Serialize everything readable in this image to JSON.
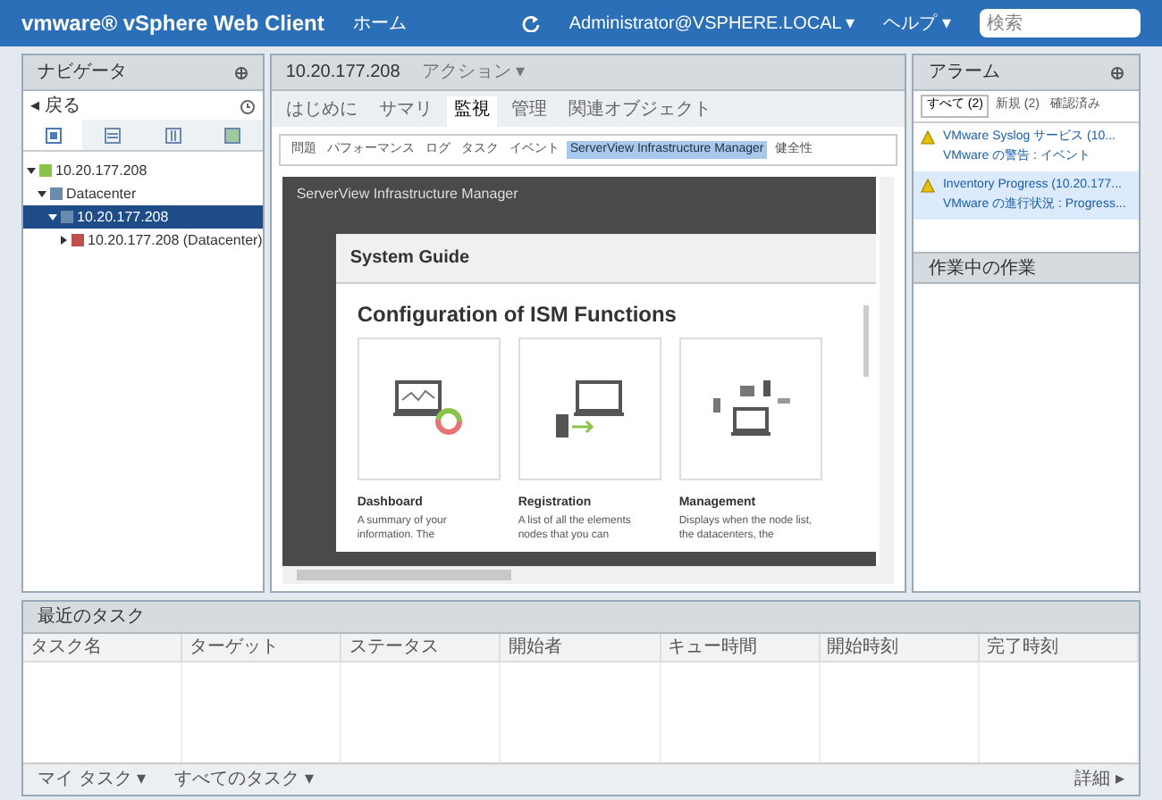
{
  "header": {
    "product": "vmware® vSphere Web Client",
    "home": "ホーム",
    "user": "Administrator@VSPHERE.LOCAL ▾",
    "help": "ヘルプ ▾",
    "search": {
      "placeholder": "検索"
    }
  },
  "navigator": {
    "title": "ナビゲータ",
    "back": "◂ 戻る",
    "tabs": [
      {
        "selected": true
      },
      {
        "selected": false
      },
      {
        "selected": false
      },
      {
        "selected": false
      }
    ],
    "tree": [
      {
        "label": "10.20.177.208",
        "selected": false,
        "expanded": true,
        "children": [
          {
            "label": "Datacenter",
            "selected": false,
            "expanded": true,
            "children": [
              {
                "label": "10.20.177.208",
                "selected": true,
                "expanded": true,
                "children": [
                  {
                    "label": "10.20.177.208 (Datacenter)",
                    "selected": false,
                    "expanded": false
                  }
                ]
              }
            ]
          }
        ]
      }
    ]
  },
  "main": {
    "title": "10.20.177.208",
    "actions": "アクション ▾",
    "tabs": [
      {
        "label": "はじめに",
        "selected": false
      },
      {
        "label": "サマリ",
        "selected": false
      },
      {
        "label": "監視",
        "selected": true
      },
      {
        "label": "管理",
        "selected": false
      },
      {
        "label": "関連オブジェクト",
        "selected": false
      }
    ],
    "subtabs": [
      {
        "label": "問題",
        "selected": false
      },
      {
        "label": "パフォーマンス",
        "selected": false
      },
      {
        "label": "ログ",
        "selected": false
      },
      {
        "label": "タスク",
        "selected": false
      },
      {
        "label": "イベント",
        "selected": false
      },
      {
        "label": "ServerView Infrastructure Manager",
        "selected": true
      },
      {
        "label": "健全性",
        "selected": false
      }
    ],
    "app_title": "ServerView Infrastructure Manager",
    "dialog": {
      "title": "System Guide",
      "heading": "Configuration of ISM Functions",
      "cards": [
        {
          "kind": "dashboard",
          "title": "Dashboard",
          "text": "A summary of your information. The"
        },
        {
          "kind": "registration",
          "title": "Registration",
          "text": "A list of all the elements nodes that you can"
        },
        {
          "kind": "management",
          "title": "Management",
          "text": "Displays when the node list, the datacenters, the"
        }
      ]
    }
  },
  "alarms": {
    "title": "アラーム",
    "tabs": [
      {
        "label": "すべて (2)",
        "selected": true
      },
      {
        "label": "新規 (2)",
        "selected": false
      },
      {
        "label": "確認済み",
        "selected": false
      }
    ],
    "items": [
      {
        "title": "VMware Syslog サービス (10...",
        "text": "VMware の警告 : イベント",
        "selected": false
      },
      {
        "title": "Inventory Progress (10.20.177...",
        "text": "VMware の進行状況 : Progress...",
        "selected": true
      }
    ]
  },
  "work": {
    "title": "作業中の作業"
  },
  "tasks": {
    "title": "最近のタスク",
    "columns": [
      "タスク名",
      "ターゲット",
      "ステータス",
      "開始者",
      "キュー時間",
      "開始時刻",
      "完了時刻"
    ],
    "filter": "マイ タスク ▾",
    "scope": "すべてのタスク ▾",
    "more": "詳細 ▸"
  }
}
